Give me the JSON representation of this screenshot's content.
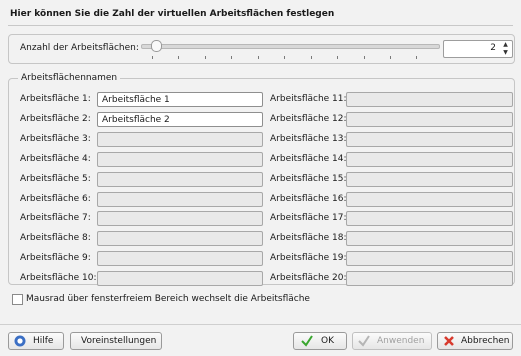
{
  "header": {
    "title": "Hier können Sie die Zahl der virtuellen Arbeitsflächen festlegen"
  },
  "count": {
    "label": "Anzahl der Arbeitsflächen:",
    "value": "2",
    "slider_level": 0.05
  },
  "names": {
    "legend": "Arbeitsflächennamen",
    "left": [
      {
        "label": "Arbeitsfläche 1:",
        "value": "Arbeitsfläche 1",
        "enabled": true
      },
      {
        "label": "Arbeitsfläche 2:",
        "value": "Arbeitsfläche 2",
        "enabled": true
      },
      {
        "label": "Arbeitsfläche 3:",
        "value": "",
        "enabled": false
      },
      {
        "label": "Arbeitsfläche 4:",
        "value": "",
        "enabled": false
      },
      {
        "label": "Arbeitsfläche 5:",
        "value": "",
        "enabled": false
      },
      {
        "label": "Arbeitsfläche 6:",
        "value": "",
        "enabled": false
      },
      {
        "label": "Arbeitsfläche 7:",
        "value": "",
        "enabled": false
      },
      {
        "label": "Arbeitsfläche 8:",
        "value": "",
        "enabled": false
      },
      {
        "label": "Arbeitsfläche 9:",
        "value": "",
        "enabled": false
      },
      {
        "label": "Arbeitsfläche 10:",
        "value": "",
        "enabled": false
      }
    ],
    "right": [
      {
        "label": "Arbeitsfläche 11:",
        "value": "",
        "enabled": false
      },
      {
        "label": "Arbeitsfläche 12:",
        "value": "",
        "enabled": false
      },
      {
        "label": "Arbeitsfläche 13:",
        "value": "",
        "enabled": false
      },
      {
        "label": "Arbeitsfläche 14:",
        "value": "",
        "enabled": false
      },
      {
        "label": "Arbeitsfläche 15:",
        "value": "",
        "enabled": false
      },
      {
        "label": "Arbeitsfläche 16:",
        "value": "",
        "enabled": false
      },
      {
        "label": "Arbeitsfläche 17:",
        "value": "",
        "enabled": false
      },
      {
        "label": "Arbeitsfläche 18:",
        "value": "",
        "enabled": false
      },
      {
        "label": "Arbeitsfläche 19:",
        "value": "",
        "enabled": false
      },
      {
        "label": "Arbeitsfläche 20:",
        "value": "",
        "enabled": false
      }
    ]
  },
  "wheel_option": {
    "label": "Mausrad über fensterfreiem Bereich wechselt die Arbeitsfläche",
    "checked": false
  },
  "buttons": {
    "help": "Hilfe",
    "defaults": "Voreinstellungen",
    "ok": "OK",
    "apply": "Anwenden",
    "cancel": "Abbrechen"
  },
  "colors": {
    "ok_check": "#3aa62f",
    "cancel_x": "#d83a2e",
    "help_blue": "#3b6fc4"
  }
}
